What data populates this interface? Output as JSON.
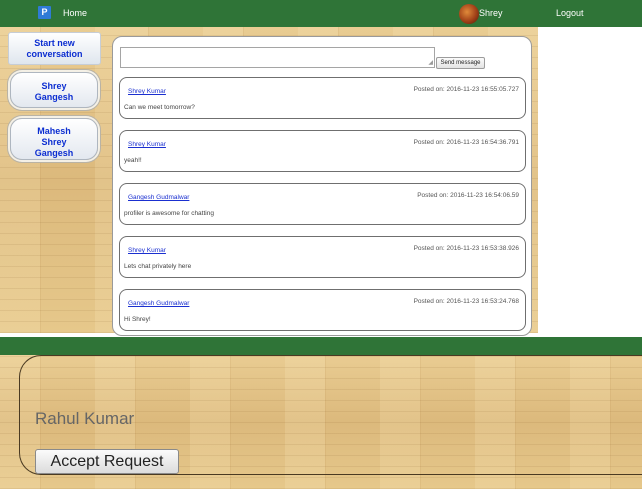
{
  "nav": {
    "logo": "P",
    "home": "Home",
    "user": "Shrey",
    "logout": "Logout"
  },
  "sidebar": {
    "new_conversation": "Start new conversation",
    "conversations": [
      {
        "label": "Shrey\nGangesh"
      },
      {
        "label": "Mahesh\nShrey\nGangesh"
      }
    ]
  },
  "composer": {
    "message_value": "",
    "send_label": "Send message"
  },
  "posts": [
    {
      "author": "Shrey Kumar",
      "date": "Posted on: 2016-11-23 16:55:05.727",
      "text": "Can we meet tomorrow?"
    },
    {
      "author": "Shrey Kumar",
      "date": "Posted on: 2016-11-23 16:54:36.791",
      "text": "yeah!!"
    },
    {
      "author": "Gangesh Gudmalwar",
      "date": "Posted on: 2016-11-23 16:54:06.59",
      "text": "profiler is awesome for chatting"
    },
    {
      "author": "Shrey Kumar",
      "date": "Posted on: 2016-11-23 16:53:38.926",
      "text": "Lets chat privately here"
    },
    {
      "author": "Gangesh Gudmalwar",
      "date": "Posted on: 2016-11-23 16:53:24.768",
      "text": "Hi Shrey!"
    }
  ],
  "request": {
    "name": "Rahul Kumar",
    "accept_label": "Accept Request"
  },
  "colors": {
    "nav_green": "#2f7437",
    "link_blue": "#1a2fd0",
    "sidebar_blue": "#0c2ed1",
    "wood": "#e3c58a"
  },
  "icons": {
    "logo": "app-logo-icon",
    "avatar": "user-avatar"
  }
}
